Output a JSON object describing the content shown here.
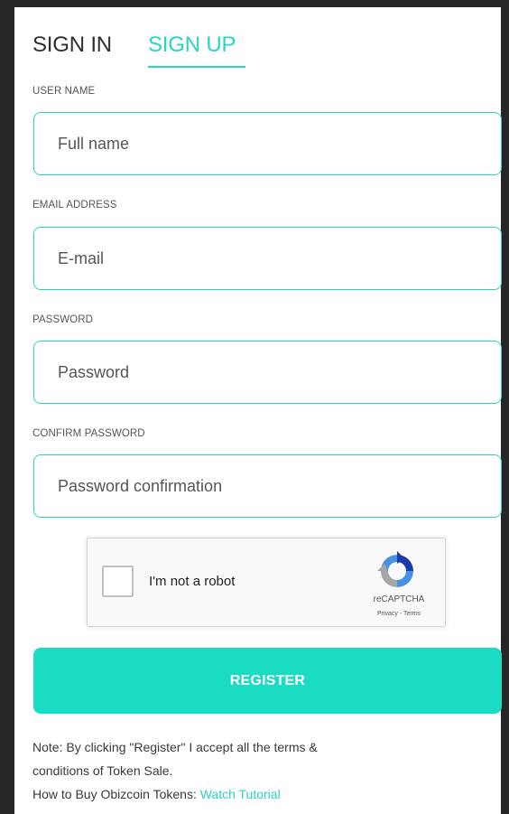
{
  "tabs": {
    "sign_in": "SIGN IN",
    "sign_up": "SIGN UP",
    "active": "sign_up"
  },
  "form": {
    "username": {
      "label": "USER NAME",
      "placeholder": "Full name",
      "value": ""
    },
    "email": {
      "label": "EMAIL ADDRESS",
      "placeholder": "E-mail",
      "value": ""
    },
    "password": {
      "label": "PASSWORD",
      "placeholder": "Password",
      "value": ""
    },
    "confirm_password": {
      "label": "CONFIRM PASSWORD",
      "placeholder": "Password confirmation",
      "value": ""
    }
  },
  "recaptcha": {
    "label": "I'm not a robot",
    "brand": "reCAPTCHA",
    "links": "Privacy - Terms",
    "checked": false
  },
  "register_button": "REGISTER",
  "note": {
    "line1": "Note: By clicking \"Register\" I accept all the terms &",
    "line2": "conditions of Token Sale.",
    "line3_prefix": "How to Buy Obizcoin Tokens: ",
    "link": "Watch Tutorial"
  },
  "colors": {
    "accent": "#2bd4bd",
    "button": "#19dcc2",
    "background": "#262626",
    "panel": "#ffffff"
  }
}
